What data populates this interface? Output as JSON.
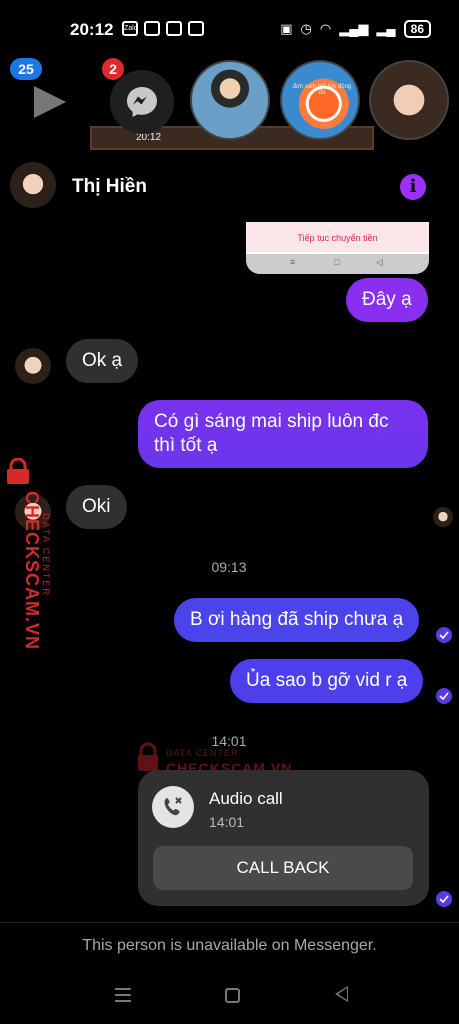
{
  "status_bar": {
    "time": "20:12",
    "left_icons": [
      "zalo-icon",
      "cloud-icon",
      "pinwheel-icon",
      "linkedin-icon"
    ],
    "zalo_label": "Zalo",
    "battery": "86"
  },
  "chat_heads": {
    "unread_left": "25",
    "unread_messenger": "2",
    "mini_time": "20:12",
    "head2_caption": "đơn cam trái lực đồng đa"
  },
  "header": {
    "contact_name": "Thị Hiền",
    "info_glyph": "i"
  },
  "image_message": {
    "button_text": "Tiếp tục chuyển tiền"
  },
  "messages": {
    "out1": "Đây ạ",
    "in1": "Ok ạ",
    "out2": "Có gì sáng mai ship luôn đc thì tốt ạ",
    "in2": "Oki",
    "time1": "09:13",
    "out3": "B ơi hàng đã ship chưa ạ",
    "out4": "Ủa sao b gỡ vid r ạ",
    "time2": "14:01"
  },
  "call_card": {
    "title": "Audio call",
    "time": "14:01",
    "button": "CALL BACK"
  },
  "watermark": {
    "brand": "CHECKSCAM.VN",
    "sub": "DATA CENTER"
  },
  "footer": {
    "notice": "This person is unavailable on Messenger."
  },
  "colors": {
    "accent_purple": "#8a2ff0",
    "accent_blue": "#4a44ea",
    "incoming_bubble": "#303030",
    "watermark_red": "#d52a2a"
  }
}
